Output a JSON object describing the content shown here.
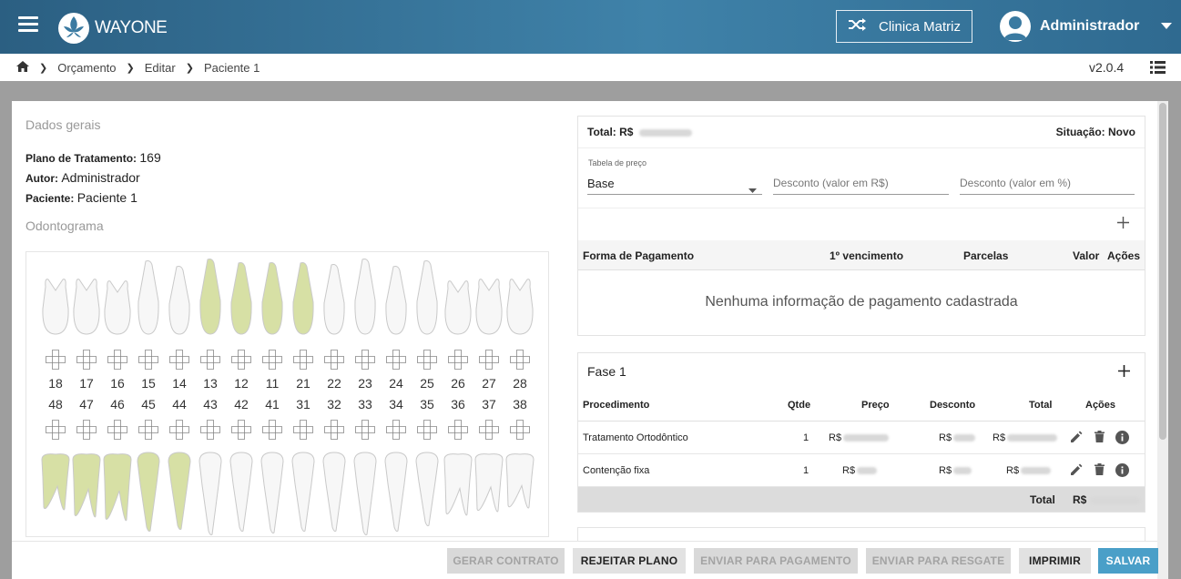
{
  "header": {
    "logo_text": "WAYONE",
    "clinic_label": "Clinica Matriz",
    "user_name": "Administrador"
  },
  "breadcrumb": {
    "items": [
      "Orçamento",
      "Editar",
      "Paciente 1"
    ],
    "version": "v2.0.4"
  },
  "general": {
    "section_title": "Dados gerais",
    "plan_label": "Plano de Tratamento:",
    "plan_value": "169",
    "author_label": "Autor:",
    "author_value": "Administrador",
    "patient_label": "Paciente:",
    "patient_value": "Paciente 1",
    "odontogram_title": "Odontograma"
  },
  "odontogram": {
    "upper": [
      "18",
      "17",
      "16",
      "15",
      "14",
      "13",
      "12",
      "11",
      "21",
      "22",
      "23",
      "24",
      "25",
      "26",
      "27",
      "28"
    ],
    "lower": [
      "48",
      "47",
      "46",
      "45",
      "44",
      "43",
      "42",
      "41",
      "31",
      "32",
      "33",
      "34",
      "35",
      "36",
      "37",
      "38"
    ],
    "highlighted_upper": [
      "13",
      "11",
      "21"
    ],
    "highlighted_upper_partial": [
      "12"
    ],
    "highlighted_lower": [
      "48",
      "47",
      "46",
      "45",
      "44"
    ],
    "highlight_color": "#d7e0a5"
  },
  "summary": {
    "total_label": "Total: R$",
    "status_label": "Situação:",
    "status_value": "Novo",
    "price_table_label": "Tabela de preço",
    "price_table_value": "Base",
    "discount_value_placeholder": "Desconto (valor em R$)",
    "discount_percent_placeholder": "Desconto (valor em %)"
  },
  "payments": {
    "columns": [
      "Forma de Pagamento",
      "1º vencimento",
      "Parcelas",
      "Valor",
      "Ações"
    ],
    "empty_message": "Nenhuma informação de pagamento cadastrada"
  },
  "phase": {
    "title": "Fase 1",
    "columns": [
      "Procedimento",
      "Qtde",
      "Preço",
      "Desconto",
      "Total",
      "Ações"
    ],
    "rows": [
      {
        "procedure": "Tratamento Ortodôntico",
        "qty": "1",
        "price_prefix": "R$",
        "discount_prefix": "R$",
        "total_prefix": "R$"
      },
      {
        "procedure": "Contenção fixa",
        "qty": "1",
        "price_prefix": "R$",
        "discount_prefix": "R$",
        "total_prefix": "R$"
      }
    ],
    "total_label": "Total",
    "total_prefix": "R$"
  },
  "footer": {
    "buttons": [
      {
        "label": "GERAR CONTRATO",
        "state": "disabled"
      },
      {
        "label": "REJEITAR PLANO",
        "state": "light"
      },
      {
        "label": "ENVIAR PARA PAGAMENTO",
        "state": "disabled"
      },
      {
        "label": "ENVIAR PARA RESGATE",
        "state": "disabled"
      },
      {
        "label": "IMPRIMIR",
        "state": "light"
      },
      {
        "label": "SALVAR",
        "state": "primary"
      }
    ]
  },
  "colors": {
    "header_gradient_start": "#2b5f82",
    "header_gradient_mid": "#3f82a9",
    "primary_button": "#4a9fc8"
  },
  "icons": [
    "menu-icon",
    "shuffle-icon",
    "user-avatar-icon",
    "chevron-down-icon",
    "home-icon",
    "list-icon",
    "add-icon",
    "edit-icon",
    "delete-icon",
    "info-icon"
  ]
}
